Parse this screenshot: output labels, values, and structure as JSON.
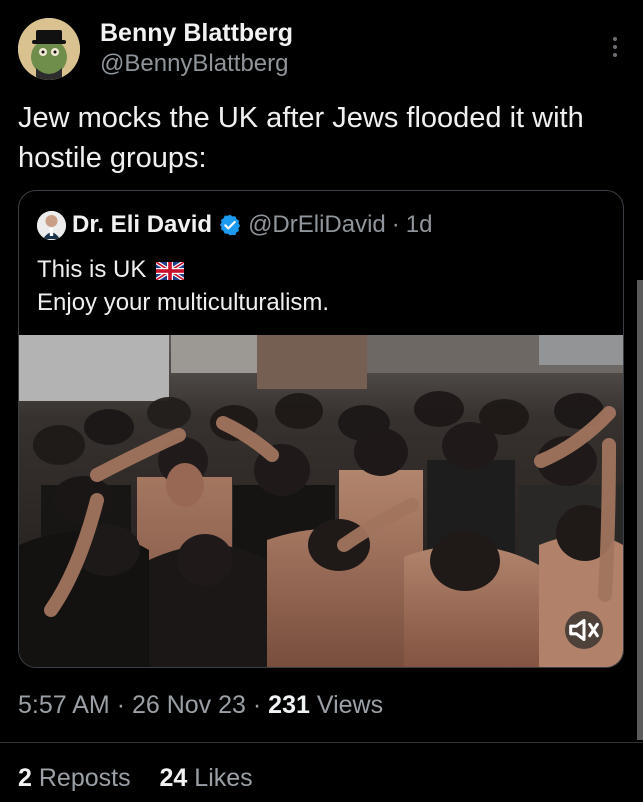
{
  "tweet": {
    "author": {
      "display_name": "Benny Blattberg",
      "handle": "@BennyBlattberg",
      "avatar_icon": "profile-avatar-icon"
    },
    "more_icon": "more-options-icon",
    "text": "Jew mocks the UK after Jews flooded it with hostile groups:",
    "quoted_tweet": {
      "author": {
        "display_name": "Dr. Eli David",
        "handle": "@DrEliDavid",
        "age": "1d",
        "separator": "·",
        "verified_icon": "verified-badge-icon"
      },
      "lines": [
        "This is UK",
        "Enjoy your multiculturalism."
      ],
      "flag_icon": "uk-flag-icon",
      "media": {
        "type": "video-thumbnail",
        "mute_icon": "mute-icon"
      }
    },
    "meta": {
      "time": "5:57 AM",
      "sep_1": "·",
      "date": "26 Nov 23",
      "sep_2": "·",
      "views_count": "231",
      "views_label": "Views"
    },
    "stats": {
      "reposts_count": "2",
      "reposts_label": "Reposts",
      "likes_count": "24",
      "likes_label": "Likes"
    }
  },
  "colors": {
    "background": "#000000",
    "text_primary": "#e7e9ea",
    "text_secondary": "#8f959b",
    "border": "#3a3f45",
    "verified_blue": "#1d9bf0"
  }
}
